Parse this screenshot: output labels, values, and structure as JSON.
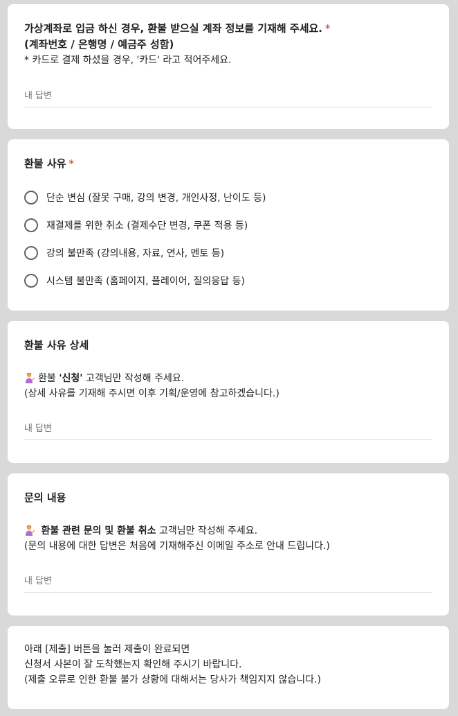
{
  "q1": {
    "title_line1": "가상계좌로 입금 하신 경우, 환불 받으실 계좌 정보를 기재해 주세요.",
    "required_mark": "*",
    "title_line2": "(계좌번호 / 은행명 / 예금주 성함)",
    "note": "* 카드로 결제 하셨을 경우, '카드' 라고 적어주세요.",
    "answer_placeholder": "내 답변"
  },
  "q2": {
    "title": "환불 사유",
    "required_mark": "*",
    "options": [
      "단순 변심 (잘못 구매, 강의 변경, 개인사정, 난이도 등)",
      "재결제를 위한 취소 (결제수단 변경, 쿠폰 적용 등)",
      "강의 불만족 (강의내용, 자료, 연사, 멘토 등)",
      "시스템 불만족 (홈페이지, 플레이어, 질의응답 등)"
    ]
  },
  "q3": {
    "title": "환불 사유 상세",
    "desc_pre": "환불 ",
    "desc_bold": "'신청'",
    "desc_post": " 고객님만 작성해 주세요.",
    "desc_line2": "(상세 사유를 기재해 주시면 이후 기획/운영에 참고하겠습니다.)",
    "answer_placeholder": "내 답변",
    "emoji_icon": "person-tipping-hand-icon"
  },
  "q4": {
    "title": "문의 내용",
    "desc_bold": "환불 관련 문의 및 환불 취소",
    "desc_post": " 고객님만 작성해 주세요.",
    "desc_line2": "(문의 내용에 대한 답변은 처음에 기재해주신 이메일 주소로 안내 드립니다.)",
    "answer_placeholder": "내 답변",
    "emoji_icon": "person-tipping-hand-icon"
  },
  "notice": {
    "line1": "아래 [제출] 버튼을 눌러 제출이 완료되면",
    "line2": "신청서 사본이 잘 도착했는지 확인해 주시기 바랍니다.",
    "line3": "(제출 오류로 인한 환불 불가 상황에 대해서는 당사가 책임지지 않습니다.)"
  },
  "colors": {
    "background": "#d9d9d9",
    "card": "#ffffff",
    "required": "#d93025",
    "radio_border": "#5f6368",
    "placeholder": "#70757a",
    "underline": "#dadce0"
  }
}
